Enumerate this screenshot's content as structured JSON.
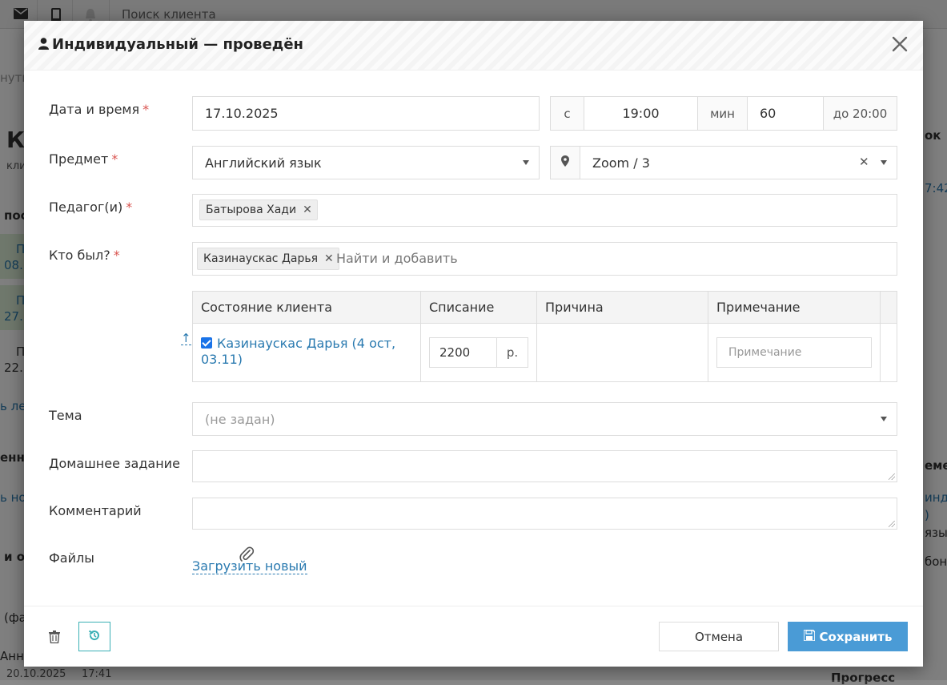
{
  "background": {
    "search_placeholder": "Поиск клиента",
    "snippets": [
      "нуть",
      "Ка",
      "кли",
      "пос",
      "П",
      "08.",
      "П",
      "27.",
      "П",
      "22.",
      "ь ле",
      "енн",
      "ь но",
      "и о",
      "(фа",
      "Анна",
      "20.10.2025",
      "17:41",
      "ок",
      "7:42",
      "еме",
      "инд",
      ")",
      "язы",
      "бон",
      "Прогресс"
    ]
  },
  "modal": {
    "title": "Индивидуальный — проведён",
    "fields": {
      "datetime": {
        "label": "Дата и время",
        "date": "17.10.2025",
        "from_label": "с",
        "time": "19:00",
        "duration_label": "мин",
        "duration": "60",
        "until": "до 20:00"
      },
      "subject": {
        "label": "Предмет",
        "value": "Английский язык",
        "location": "Zoom / 3"
      },
      "teachers": {
        "label": "Педагог(и)",
        "tags": [
          "Батырова Хади"
        ]
      },
      "attendees": {
        "label": "Кто был?",
        "tags": [
          "Казинаускас Дарья"
        ],
        "search_placeholder": "Найти и добавить"
      },
      "table": {
        "headers": [
          "Состояние клиента",
          "Списание",
          "Причина",
          "Примечание"
        ],
        "rows": [
          {
            "client": "Казинаускас Дарья (4 ост, 03.11)",
            "checked": true,
            "charge": "2200",
            "currency": "р.",
            "reason": "",
            "note_placeholder": "Примечание"
          }
        ]
      },
      "topic": {
        "label": "Тема",
        "value": "(не задан)"
      },
      "homework": {
        "label": "Домашнее задание",
        "value": ""
      },
      "comment": {
        "label": "Комментарий",
        "value": ""
      },
      "files": {
        "label": "Файлы",
        "upload_label": "Загрузить новый"
      }
    },
    "footer": {
      "cancel_label": "Отмена",
      "save_label": "Сохранить"
    },
    "colors": {
      "accent": "#4a9bd6",
      "link": "#2a7ab0",
      "required": "#d9534f",
      "history_border": "#3bb0b5"
    }
  }
}
